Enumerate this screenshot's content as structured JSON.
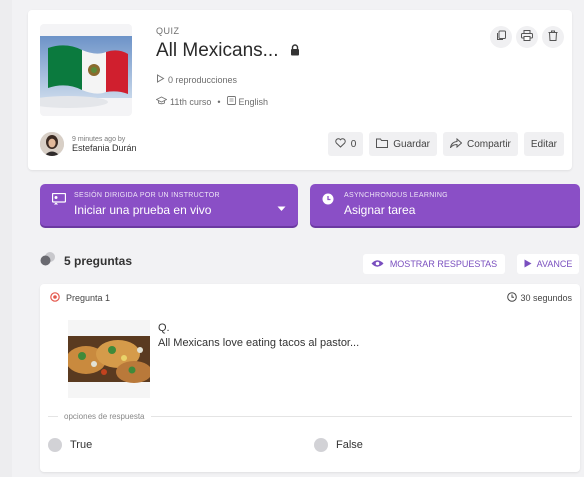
{
  "quiz": {
    "type_label": "QUIZ",
    "title": "All Mexicans...",
    "plays": "0 reproducciones",
    "grade": "11th curso",
    "language": "English",
    "author_time": "9 minutes ago by",
    "author_name": "Estefania Durán",
    "likes": "0",
    "save_label": "Guardar",
    "share_label": "Compartir",
    "edit_label": "Editar"
  },
  "live": {
    "small_label": "SESIÓN DIRIGIDA POR UN INSTRUCTOR",
    "big_label": "Iniciar una prueba en vivo"
  },
  "homework": {
    "small_label": "ASYNCHRONOUS LEARNING",
    "big_label": "Asignar tarea"
  },
  "questions": {
    "count_label": "5 preguntas",
    "show_answers_label": "MOSTRAR RESPUESTAS",
    "preview_label": "AVANCE"
  },
  "question1": {
    "label": "Pregunta 1",
    "time": "30 segundos",
    "prefix": "Q.",
    "text": "All Mexicans love eating tacos al pastor...",
    "options_label": "opciones de respuesta",
    "options": [
      "True",
      "False"
    ]
  },
  "colors": {
    "accent": "#8a4fc6",
    "accent_text": "#7a4fbf"
  }
}
